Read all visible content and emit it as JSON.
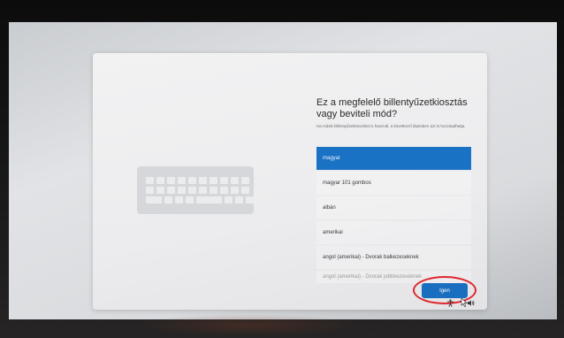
{
  "setup": {
    "title": "Ez a megfelelő billentyűzetkiosztás vagy beviteli mód?",
    "subtitle": "Ha másik billentyűzetkiosztást is használ, a következő lépésben azt is hozzáadhatja.",
    "options": [
      {
        "label": "magyar",
        "selected": true
      },
      {
        "label": "magyar 101 gombos",
        "selected": false
      },
      {
        "label": "albán",
        "selected": false
      },
      {
        "label": "amerikai",
        "selected": false
      },
      {
        "label": "angol (amerikai) - Dvorak balkezeseknek",
        "selected": false
      },
      {
        "label": "angol (amerikai) - Dvorak jobbkezeseknek",
        "selected": false
      }
    ],
    "confirm_button": "Igen"
  },
  "taskbar": {
    "icons": [
      "accessibility-icon",
      "volume-icon"
    ]
  },
  "colors": {
    "accent": "#1a72c4",
    "annotation_circle": "#e0262e"
  }
}
